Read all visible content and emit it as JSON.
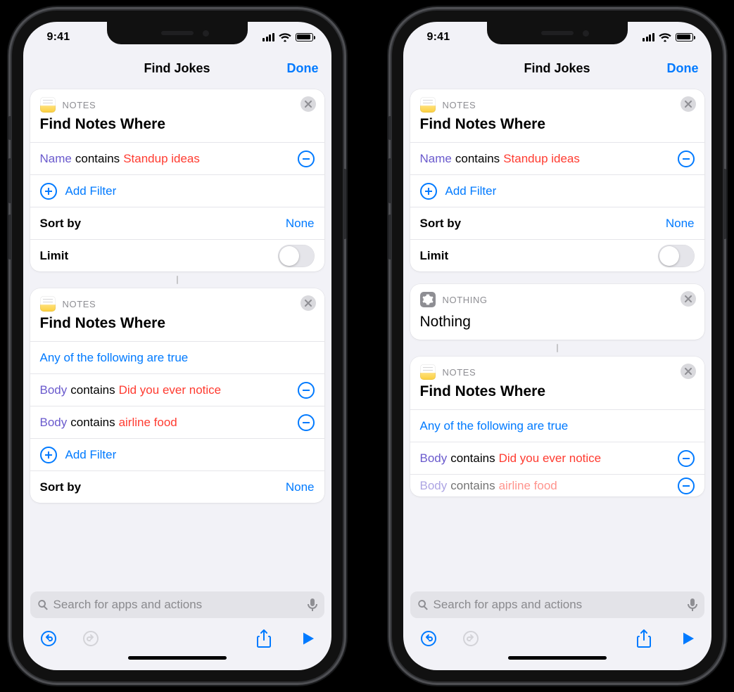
{
  "status": {
    "time": "9:41"
  },
  "nav": {
    "title": "Find Jokes",
    "done": "Done"
  },
  "labels": {
    "notes_app": "NOTES",
    "nothing_app": "NOTHING",
    "find_notes_title": "Find Notes Where",
    "nothing_title": "Nothing",
    "add_filter": "Add Filter",
    "sort_by": "Sort by",
    "sort_by_value": "None",
    "limit": "Limit",
    "any_true": "Any of the following are true",
    "name_key": "Name",
    "body_key": "Body",
    "contains": "contains",
    "standup": "Standup ideas",
    "notice": "Did you ever notice",
    "airline": "airline food",
    "search_ph": "Search for apps and actions"
  }
}
